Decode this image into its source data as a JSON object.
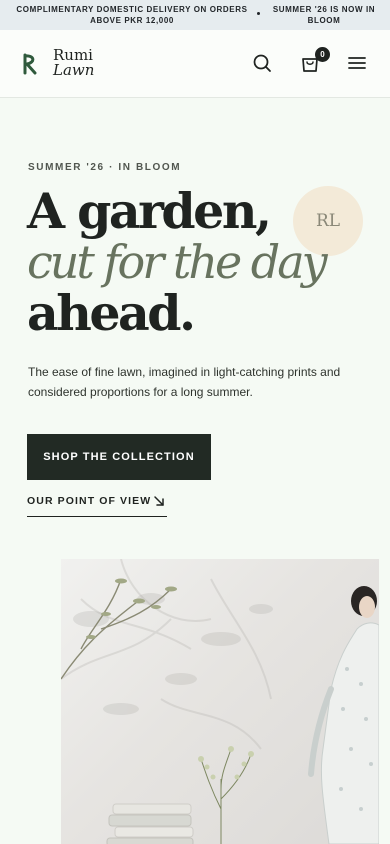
{
  "announcement": {
    "message_1": "COMPLIMENTARY DOMESTIC DELIVERY ON ORDERS ABOVE PKR 12,000",
    "message_2": "SUMMER '26 IS NOW IN BLOOM"
  },
  "header": {
    "logo_line_1": "Rumi",
    "logo_line_2": "Lawn",
    "cart_count": "0",
    "icons": [
      "search-icon",
      "bag-icon",
      "menu-icon"
    ]
  },
  "hero": {
    "eyebrow": "SUMMER '26 · IN BLOOM",
    "headline_line_1": "A garden,",
    "headline_line_2": "cut for the day",
    "headline_line_3": "ahead.",
    "monogram": "RL",
    "description": "The ease of fine lawn, imagined in light-catching prints and considered proportions for a long summer.",
    "cta_label": "SHOP THE COLLECTION",
    "link_label": "OUR POINT OF VIEW"
  },
  "colors": {
    "background": "#f5faf4",
    "ink": "#1f2320",
    "accent_green": "#68735f",
    "cta_bg": "#222a24",
    "monogram_bg": "#f3ead8"
  }
}
